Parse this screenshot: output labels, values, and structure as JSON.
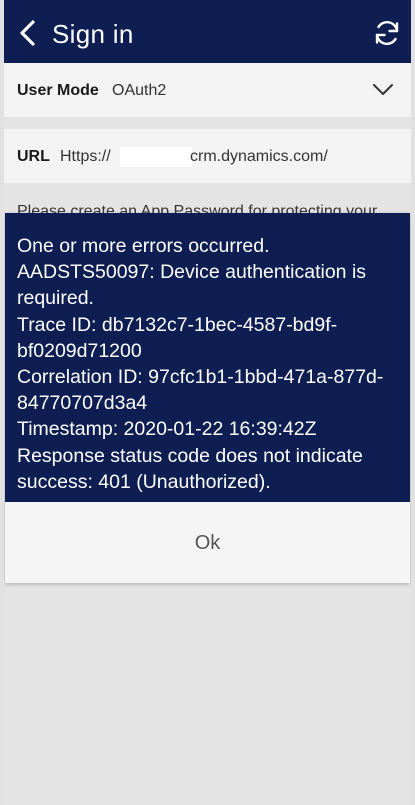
{
  "header": {
    "title": "Sign in",
    "back_icon": "chevron-left-icon",
    "refresh_icon": "refresh-icon",
    "bg_color": "#0e1e52"
  },
  "user_mode": {
    "label": "User Mode",
    "value": "OAuth2",
    "dropdown_icon": "chevron-down-icon"
  },
  "url": {
    "label": "URL",
    "value_prefix": "Https://",
    "value_suffix": "crm.dynamics.com/"
  },
  "note": "Please create an App Password for protecting your",
  "error_dialog": {
    "bg_color": "#0e1e52",
    "lines": [
      "One or more errors occurred.",
      "AADSTS50097: Device authentication is required.",
      "Trace ID: db7132c7-1bec-4587-bd9f-bf0209d71200",
      "Correlation ID: 97cfc1b1-1bbd-471a-877d-84770707d3a4",
      "Timestamp: 2020-01-22 16:39:42Z",
      "Response status code does not indicate success: 401 (Unauthorized)."
    ],
    "ok_label": "Ok"
  }
}
